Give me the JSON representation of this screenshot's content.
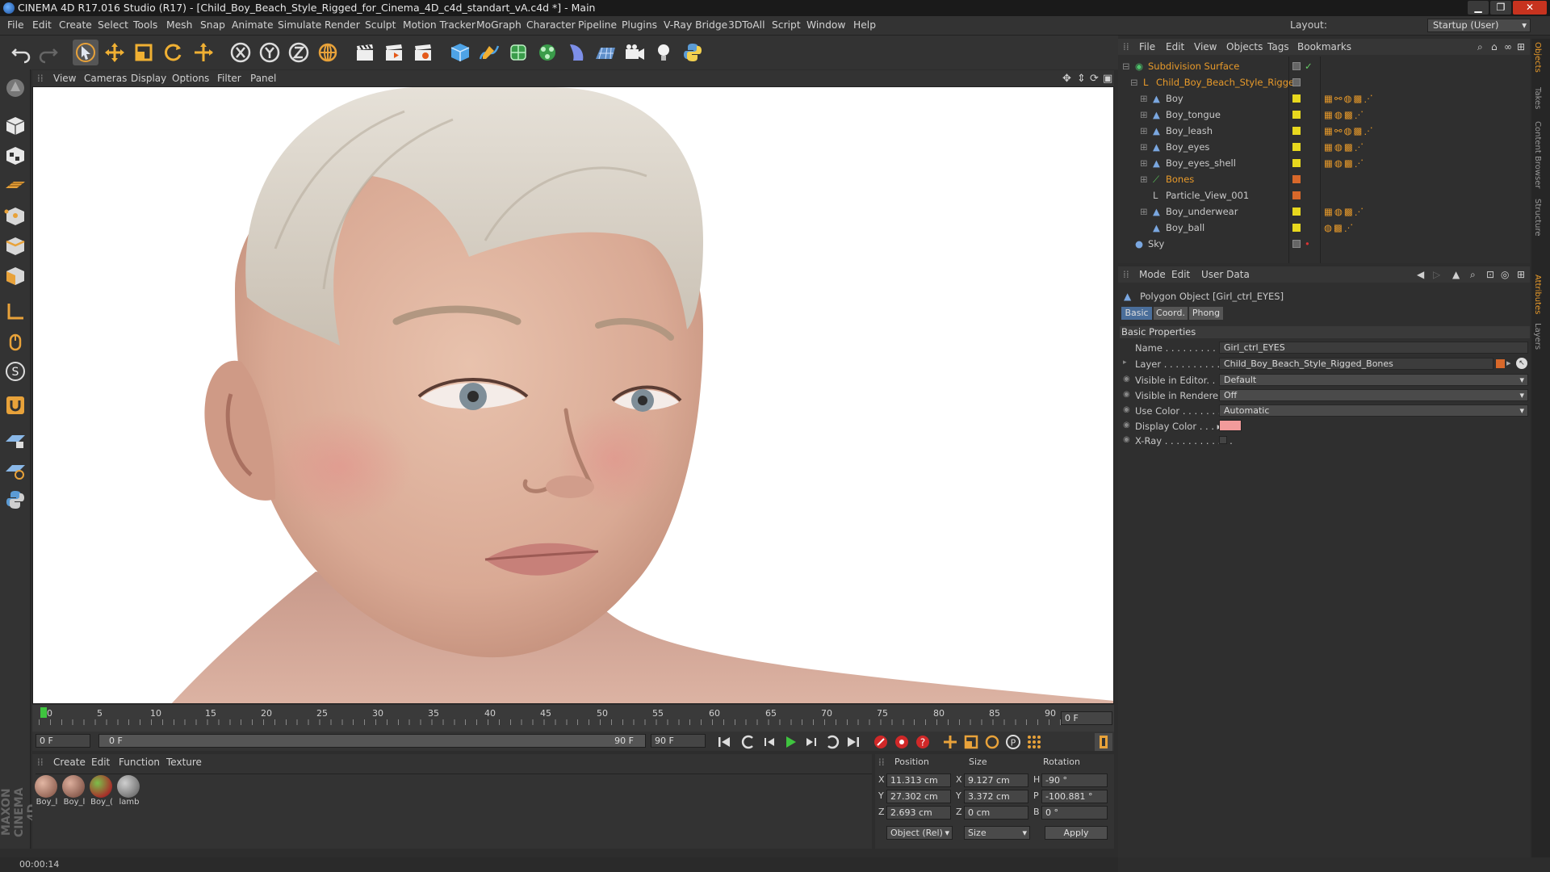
{
  "window": {
    "title": "CINEMA 4D R17.016 Studio (R17) - [Child_Boy_Beach_Style_Rigged_for_Cinema_4D_c4d_standart_vA.c4d *] - Main"
  },
  "menu": [
    "File",
    "Edit",
    "Create",
    "Select",
    "Tools",
    "Mesh",
    "Snap",
    "Animate",
    "Simulate",
    "Render",
    "Sculpt",
    "Motion Tracker",
    "MoGraph",
    "Character",
    "Pipeline",
    "Plugins",
    "V-Ray Bridge",
    "3DToAll",
    "Script",
    "Window",
    "Help"
  ],
  "layout": {
    "label": "Layout:",
    "value": "Startup (User)"
  },
  "viewport_menu": [
    "View",
    "Cameras",
    "Display",
    "Options",
    "Filter",
    "Panel"
  ],
  "timeline": {
    "ticks": [
      "0",
      "5",
      "10",
      "15",
      "20",
      "25",
      "30",
      "35",
      "40",
      "45",
      "50",
      "55",
      "60",
      "65",
      "70",
      "75",
      "80",
      "85",
      "90"
    ],
    "current_frame": "0 F"
  },
  "controls": {
    "start_field": "0 F",
    "range_start": "0 F",
    "range_end": "90 F",
    "end_field": "90 F"
  },
  "material_menu": [
    "Create",
    "Edit",
    "Function",
    "Texture"
  ],
  "materials": [
    "Boy_l",
    "Boy_l",
    "Boy_(",
    "lamb"
  ],
  "coords": {
    "headers": [
      "Position",
      "Size",
      "Rotation"
    ],
    "rows": [
      {
        "a": "X",
        "pos": "11.313 cm",
        "b": "X",
        "size": "9.127 cm",
        "c": "H",
        "rot": "-90 °"
      },
      {
        "a": "Y",
        "pos": "27.302 cm",
        "b": "Y",
        "size": "3.372 cm",
        "c": "P",
        "rot": "-100.881 °"
      },
      {
        "a": "Z",
        "pos": "2.693 cm",
        "b": "Z",
        "size": "0 cm",
        "c": "B",
        "rot": "0 °"
      }
    ],
    "mode": "Object (Rel)",
    "size_mode": "Size",
    "apply": "Apply"
  },
  "status": {
    "time": "00:00:14"
  },
  "object_menu": [
    "File",
    "Edit",
    "View",
    "Objects",
    "Tags",
    "Bookmarks"
  ],
  "objects": [
    {
      "name": "Subdivision Surface",
      "color": "orange"
    },
    {
      "name": "Child_Boy_Beach_Style_Rigged",
      "color": "orange"
    },
    {
      "name": "Boy",
      "color": "normal"
    },
    {
      "name": "Boy_tongue",
      "color": "normal"
    },
    {
      "name": "Boy_leash",
      "color": "normal"
    },
    {
      "name": "Boy_eyes",
      "color": "normal"
    },
    {
      "name": "Boy_eyes_shell",
      "color": "normal"
    },
    {
      "name": "Bones",
      "color": "orange"
    },
    {
      "name": "Particle_View_001",
      "color": "normal"
    },
    {
      "name": "Boy_underwear",
      "color": "normal"
    },
    {
      "name": "Boy_ball",
      "color": "normal"
    },
    {
      "name": "Sky",
      "color": "normal"
    }
  ],
  "attr_menu": [
    "Mode",
    "Edit",
    "User Data"
  ],
  "attr": {
    "object_title": "Polygon Object [Girl_ctrl_EYES]",
    "tabs": [
      "Basic",
      "Coord.",
      "Phong"
    ],
    "section": "Basic Properties",
    "props": [
      {
        "label": "Name . . . . . . . . . . . . .",
        "value": "Girl_ctrl_EYES"
      },
      {
        "label": "Layer . . . . . . . . . . . . .",
        "value": "Child_Boy_Beach_Style_Rigged_Bones"
      },
      {
        "label": "Visible in Editor. . .",
        "value": "Default"
      },
      {
        "label": "Visible in Renderer",
        "value": "Off"
      },
      {
        "label": "Use Color . . . . . . . .",
        "value": "Automatic"
      },
      {
        "label": "Display Color . . . ▸",
        "value": ""
      },
      {
        "label": "X-Ray . . . . . . . . . . . .",
        "value": ""
      }
    ],
    "display_color": "#f29b9b"
  },
  "right_tabs": [
    "Objects",
    "Takes",
    "Content Browser",
    "Structure",
    "Attributes",
    "Layers"
  ],
  "brand": "MAXON CINEMA 4D"
}
